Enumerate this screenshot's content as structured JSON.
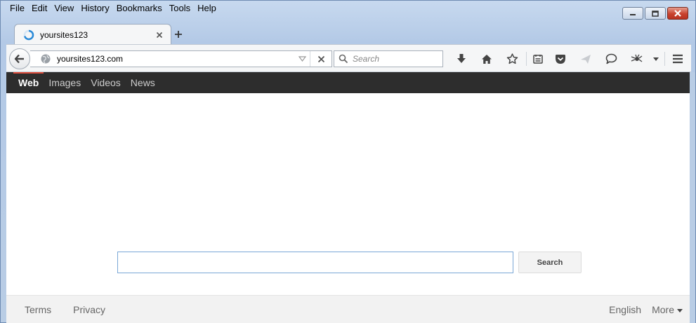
{
  "menubar": {
    "items": [
      "File",
      "Edit",
      "View",
      "History",
      "Bookmarks",
      "Tools",
      "Help"
    ]
  },
  "tab": {
    "title": "yoursites123",
    "icon": "loading-throbber-icon",
    "close_icon": "close-icon",
    "new_tab_icon": "plus-icon"
  },
  "navbar": {
    "url": "yoursites123.com",
    "search_placeholder": "Search",
    "icons": [
      "download-icon",
      "home-icon",
      "bookmark-star-icon",
      "reading-list-icon",
      "pocket-icon",
      "send-icon",
      "chat-bubble-icon",
      "extension-icon"
    ]
  },
  "content": {
    "nav": {
      "items": [
        "Web",
        "Images",
        "Videos",
        "News"
      ],
      "active_index": 0
    },
    "search_button": "Search",
    "footer": {
      "left": [
        "Terms",
        "Privacy"
      ],
      "language": "English",
      "more": "More"
    }
  },
  "colors": {
    "nav_background": "#2d2d2d",
    "active_accent": "#dd4b39",
    "search_border": "#7aa7d6"
  }
}
